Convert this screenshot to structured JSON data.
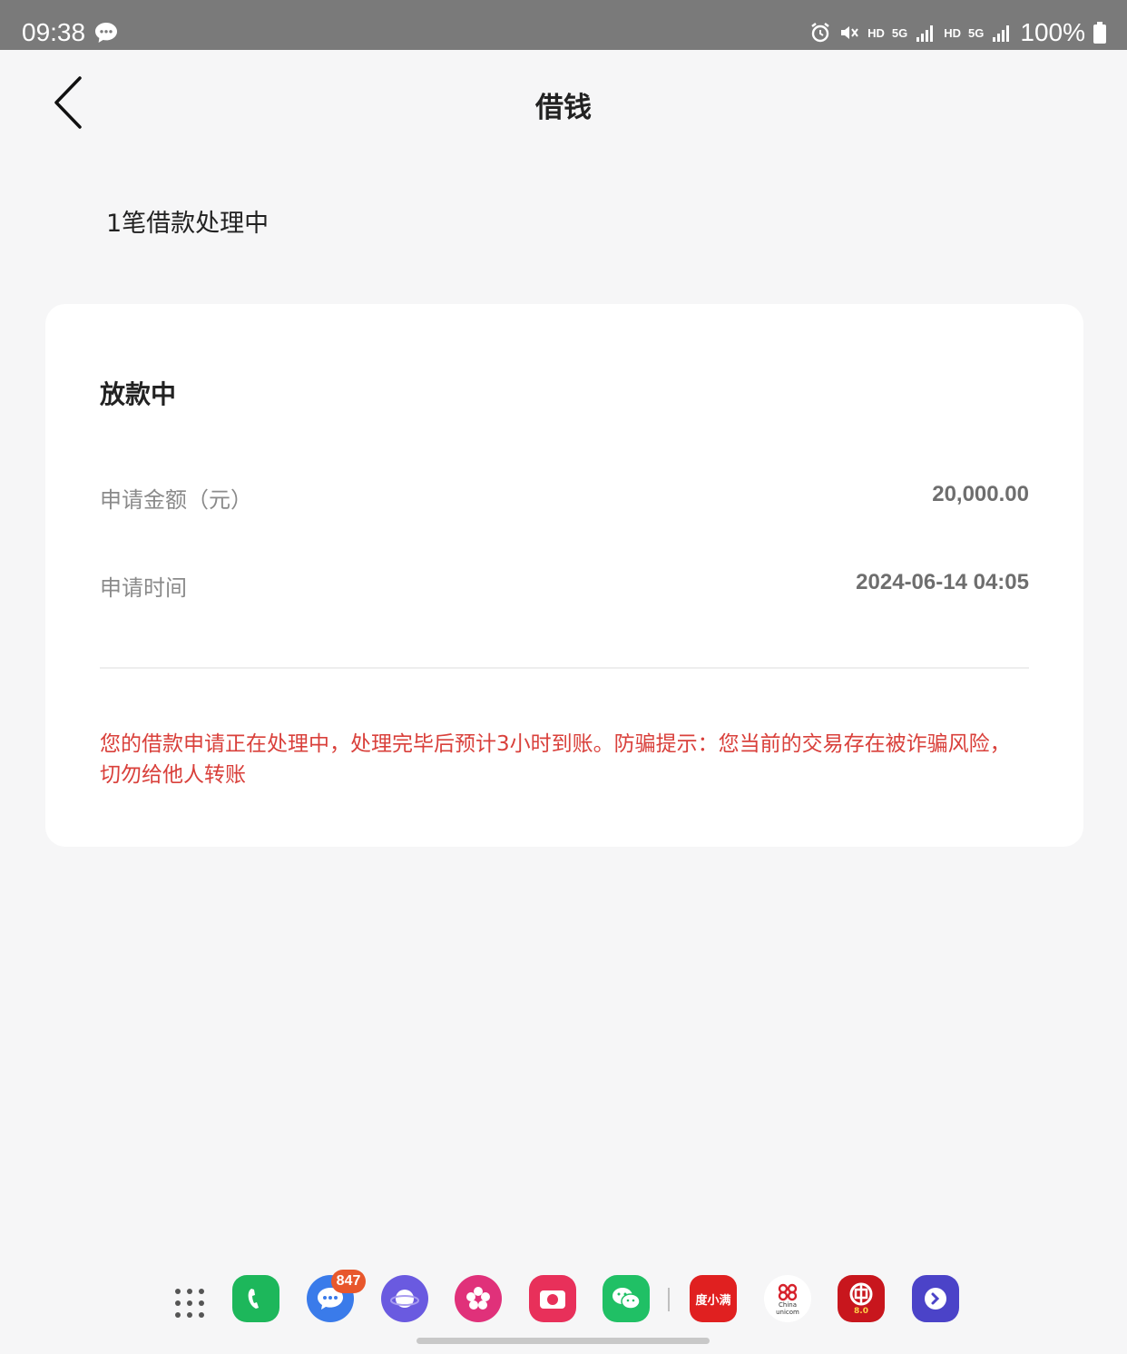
{
  "status_bar": {
    "time": "09:38",
    "network_hd_1": "HD",
    "network_5g_1": "5G",
    "network_hd_2": "HD",
    "network_5g_2": "5G",
    "battery": "100%",
    "icons": [
      "chat-notification-icon",
      "alarm-icon",
      "mute-icon",
      "signal-icon",
      "battery-icon"
    ]
  },
  "header": {
    "title": "借钱"
  },
  "pending_summary": "1笔借款处理中",
  "loan_card": {
    "status": "放款中",
    "amount_label": "申请金额（元）",
    "amount_value": "20,000.00",
    "time_label": "申请时间",
    "time_value": "2024-06-14 04:05",
    "notice": "您的借款申请正在处理中，处理完毕后预计3小时到账。防骗提示：您当前的交易存在被诈骗风险，切勿给他人转账"
  },
  "dock": {
    "messages_badge": "847",
    "apps": [
      "phone",
      "messages",
      "internet",
      "gallery",
      "camera",
      "wechat",
      "duxiaoman",
      "china-unicom",
      "bank-of-china",
      "app"
    ],
    "duxiaoman_label": "度小满",
    "unicom_label_1": "China",
    "unicom_label_2": "unicom",
    "boc_label": "8.0"
  },
  "colors": {
    "accent_red": "#d9403b",
    "background": "#f6f6f7",
    "status_bar": "#7a7a7a"
  }
}
